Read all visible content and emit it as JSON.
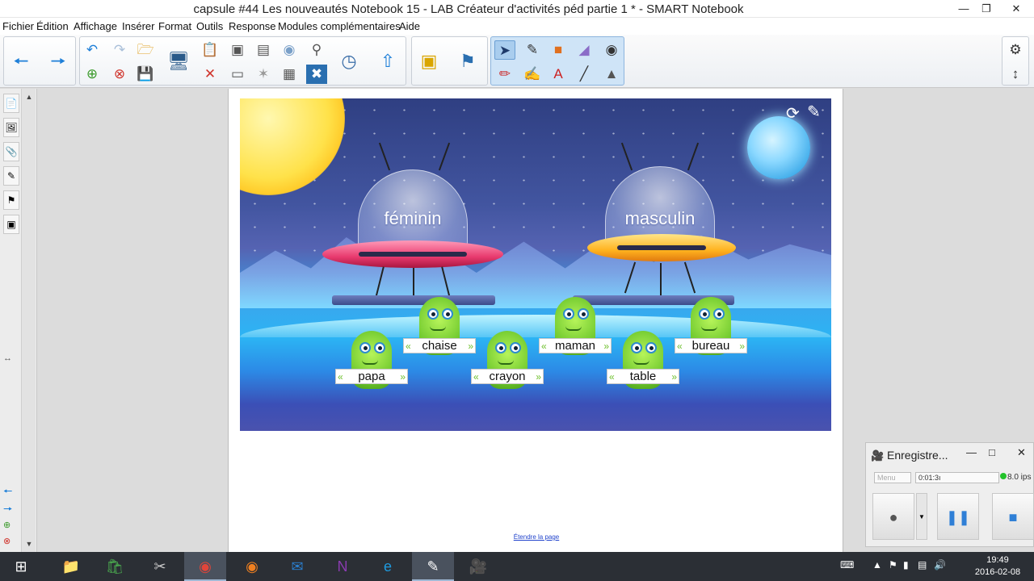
{
  "window": {
    "title": "capsule #44 Les nouveautés Notebook 15 - LAB Créateur d'activités péd partie 1 * - SMART Notebook",
    "minimize_glyph": "—",
    "maximize_glyph": "❐",
    "close_glyph": "✕"
  },
  "menu": {
    "items": [
      "Fichier",
      "Édition",
      "Affichage",
      "Insérer",
      "Format",
      "Outils",
      "Response",
      "Modules complémentaires",
      "Aide"
    ]
  },
  "toolbar": {
    "back_icon": "arrow-left-icon",
    "forward_icon": "arrow-right-icon",
    "settings_icon": "gear-icon",
    "move_icon": "updown-arrow-icon",
    "text_tool_glyph": "A",
    "accent": "#1e7fd8",
    "selected_group_color": "#cfe4f7"
  },
  "activity": {
    "ufo_left_label": "féminin",
    "ufo_right_label": "masculin",
    "words": [
      "chaise",
      "maman",
      "bureau",
      "papa",
      "crayon",
      "table"
    ],
    "reset_icon": "refresh-icon",
    "edit_icon": "pencil-icon"
  },
  "page": {
    "extend_link": "Étendre la page"
  },
  "recorder": {
    "title": "Enregistre...",
    "mode_select": "Menu",
    "elapsed": "0:01:3ı",
    "fps": "8.0 ips",
    "record_glyph": "●",
    "pause_glyph": "❚❚",
    "stop_glyph": "■"
  },
  "taskbar": {
    "time": "19:49",
    "date": "2016-02-08"
  }
}
